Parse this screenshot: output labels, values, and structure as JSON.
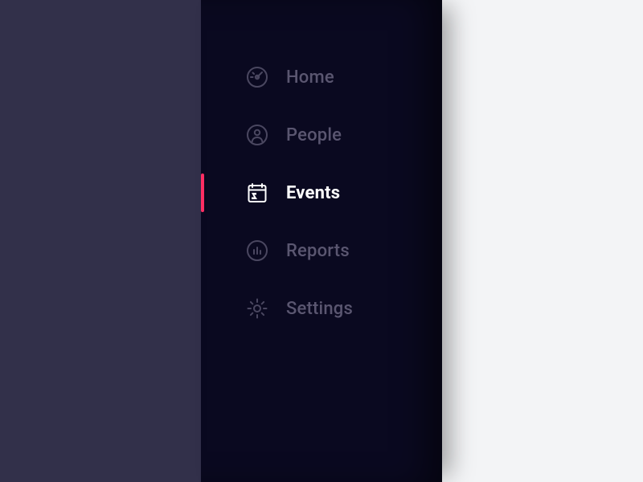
{
  "colors": {
    "left_strip_bg": "#32304a",
    "sidebar_bg": "#0a0920",
    "content_bg": "#f3f4f6",
    "nav_inactive": "#5a5670",
    "nav_active": "#ffffff",
    "accent": "#ff2e63"
  },
  "sidebar": {
    "items": [
      {
        "id": "home",
        "label": "Home",
        "icon": "gauge-icon",
        "active": false
      },
      {
        "id": "people",
        "label": "People",
        "icon": "person-circle-icon",
        "active": false
      },
      {
        "id": "events",
        "label": "Events",
        "icon": "calendar-icon",
        "active": true
      },
      {
        "id": "reports",
        "label": "Reports",
        "icon": "chart-circle-icon",
        "active": false
      },
      {
        "id": "settings",
        "label": "Settings",
        "icon": "gear-icon",
        "active": false
      }
    ]
  }
}
